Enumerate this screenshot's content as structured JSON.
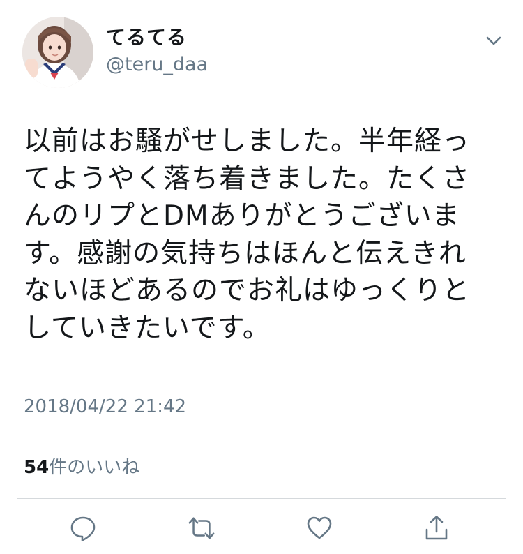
{
  "tweet": {
    "author": {
      "display_name": "てるてる",
      "handle": "@teru_daa",
      "avatar_icon": "profile-photo"
    },
    "menu_icon": "chevron-down-icon",
    "text": "以前はお騒がせしました。半年経ってようやく落ち着きました。たくさんのリプとDMありがとうございます。感謝の気持ちはほんと伝えきれないほどあるのでお礼はゆっくりとしていきたいです。",
    "timestamp": "2018/04/22 21:42",
    "likes": {
      "count": "54",
      "label": "件のいいね"
    },
    "actions": [
      {
        "name": "reply",
        "icon": "reply-icon"
      },
      {
        "name": "retweet",
        "icon": "retweet-icon"
      },
      {
        "name": "like",
        "icon": "heart-icon"
      },
      {
        "name": "share",
        "icon": "share-icon"
      }
    ]
  },
  "colors": {
    "text": "#14171a",
    "secondary": "#657786",
    "divider": "#d5d9dc",
    "icon": "#657786"
  }
}
